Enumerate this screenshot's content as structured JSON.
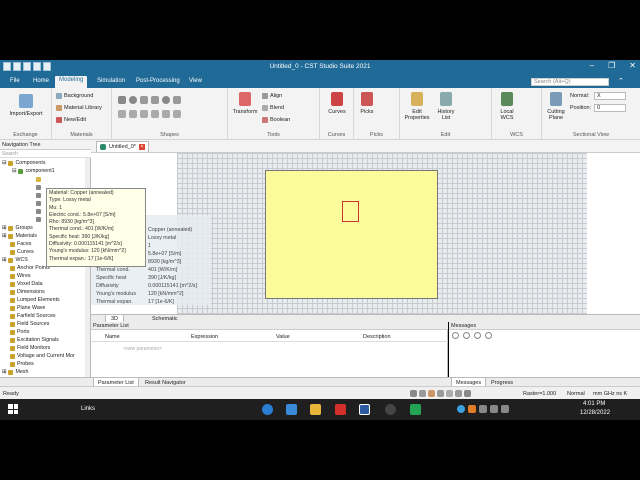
{
  "window": {
    "title": "Untitled_0 - CST Studio Suite 2021",
    "controls": [
      "–",
      "❐",
      "✕"
    ]
  },
  "menu": {
    "tabs": [
      {
        "label": "File"
      },
      {
        "label": "Home"
      },
      {
        "label": "Modeling"
      },
      {
        "label": "Simulation"
      },
      {
        "label": "Post-Processing"
      },
      {
        "label": "View"
      }
    ],
    "active": "Modeling",
    "search_placeholder": "Search (Alt+Q)"
  },
  "ribbon": {
    "groups": {
      "exchange": "Exchange",
      "materials": "Materials",
      "shapes": "Shapes",
      "tools": "Tools",
      "curves": "Curves",
      "picks": "Picks",
      "edit": "Edit",
      "wcs": "WCS",
      "sectional": "Sectional View"
    },
    "import_export": "Import/Export",
    "background": "Background",
    "material_library": "Material Library",
    "new_edit": "New/Edit",
    "transform": "Transform",
    "align": "Align",
    "blend": "Blend",
    "boolean": "Boolean",
    "curves": "Curves",
    "picks": "Picks",
    "edit_properties": "Edit Properties",
    "history_list": "History List",
    "local_wcs": "Local WCS",
    "cutting_plane": "Cutting Plane",
    "normal_label": "Normal:",
    "normal_value": "X",
    "position_label": "Position:",
    "position_value": "0"
  },
  "nav": {
    "title": "Navigation Tree",
    "search": "Search",
    "items": [
      {
        "label": "Components",
        "color": "#c9a227"
      },
      {
        "label": "component1",
        "color": "#5a9e3a"
      },
      {
        "label": "Groups",
        "color": "#c9a227"
      },
      {
        "label": "Materials",
        "color": "#c9a227"
      },
      {
        "label": "Faces",
        "color": "#c9a227"
      },
      {
        "label": "Curves",
        "color": "#c9a227"
      },
      {
        "label": "WCS",
        "color": "#c9a227"
      },
      {
        "label": "Anchor Points",
        "color": "#c9a227"
      },
      {
        "label": "Wires",
        "color": "#c9a227"
      },
      {
        "label": "Voxel Data",
        "color": "#c9a227"
      },
      {
        "label": "Dimensions",
        "color": "#c9a227"
      },
      {
        "label": "Lumped Elements",
        "color": "#c9a227"
      },
      {
        "label": "Plane Wave",
        "color": "#c9a227"
      },
      {
        "label": "Farfield Sources",
        "color": "#c9a227"
      },
      {
        "label": "Field Sources",
        "color": "#c9a227"
      },
      {
        "label": "Ports",
        "color": "#c9a227"
      },
      {
        "label": "Excitation Signals",
        "color": "#c9a227"
      },
      {
        "label": "Field Monitors",
        "color": "#c9a227"
      },
      {
        "label": "Voltage and Current Mor",
        "color": "#c9a227"
      },
      {
        "label": "Probes",
        "color": "#c9a227"
      },
      {
        "label": "Mesh",
        "color": "#c9a227"
      }
    ]
  },
  "tooltip": {
    "lines": [
      "Material: Copper (annealed)",
      "Type: Lossy metal",
      "Mu: 1",
      "Electric cond.: 5.8e+07 [S/m]",
      "Rho: 8930 [kg/m^3]",
      "Thermal cond.: 401 [W/K/m]",
      "Specific heat: 390 [J/K/kg]",
      "Diffusivity: 0.000115141 [m^2/s]",
      "Young's modulus: 120 [kN/mm^2]",
      "Thermal expan.: 17 [1e-6/K]"
    ]
  },
  "doc_tab": {
    "label": "Untitled_0*",
    "close": "×"
  },
  "properties": {
    "rows": [
      {
        "k": "",
        "v": "Copper (annealed)"
      },
      {
        "k": "",
        "v": "Lossy metal"
      },
      {
        "k": "",
        "v": "1"
      },
      {
        "k": "",
        "v": "5.8e+07 [S/m]"
      },
      {
        "k": "",
        "v": "8930 [kg/m^3]"
      },
      {
        "k": "Thermal cond.",
        "v": "401 [W/K/m]"
      },
      {
        "k": "Specific heat",
        "v": "390 [J/K/kg]"
      },
      {
        "k": "Diffusivity",
        "v": "0.000115141 [m^2/s]"
      },
      {
        "k": "Young's modulus",
        "v": "120 [kN/mm^2]"
      },
      {
        "k": "Thermal expan.",
        "v": "17 [1e-6/K]"
      }
    ]
  },
  "view_tabs": {
    "t3d": "3D",
    "schematic": "Schematic"
  },
  "param_list": {
    "title": "Parameter List",
    "columns": [
      "Name",
      "Expression",
      "Value",
      "Description"
    ],
    "new_param": "<new parameter>"
  },
  "messages": {
    "title": "Messages"
  },
  "bottom_tabs": {
    "param": "Parameter List",
    "navigator": "Result Navigator",
    "messages": "Messages",
    "progress": "Progress"
  },
  "status": {
    "left": "Ready",
    "raster": "Raster=1.000",
    "normal": "Normal",
    "units": "mm  GHz  ns  K"
  },
  "taskbar": {
    "links": "Links",
    "time": "4:01 PM",
    "date": "12/28/2022"
  }
}
